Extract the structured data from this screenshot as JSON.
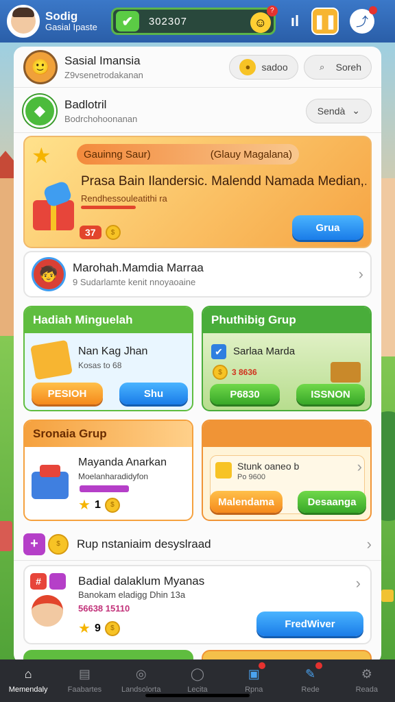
{
  "topbar": {
    "brand_title": "Sodig",
    "brand_subtitle": "Gasial Ipaste",
    "progress_value": "302307",
    "notif_count": "?",
    "signal_icon": "signal-bars-icon",
    "pause_icon": "pause-icon",
    "share_icon": "share-icon"
  },
  "profile": {
    "name": "Sasial Imansia",
    "subtitle": "Z9vsenetrodakanan",
    "pill_left": "sadoo",
    "pill_right": "Soreh"
  },
  "group_row": {
    "title": "Badlotril",
    "subtitle": "Bodrchohoonanan",
    "select_label": "Sendà"
  },
  "banner": {
    "tag_left": "Gauinng Saur)",
    "tag_right": "(Glauy Magalana)",
    "headline": "Prasa Bain Ilandersic. Malendd Namada Median,..",
    "subline": "Rendhessouleatithi ra",
    "count": "37",
    "button": "Grua",
    "colors": {
      "bg_start": "#ffe08a",
      "bg_end": "#f59d3c"
    }
  },
  "member_row": {
    "title": "Marohah.Mamdia Marraa",
    "subtitle": "9 Sudarlamte kenit nnoyaoaine"
  },
  "card_hadiah": {
    "header": "Hadiah Minguelah",
    "title": "Nan Kag Jhan",
    "subtitle": "Kosas to 68",
    "btn_left": "PESIOH",
    "btn_right": "Shu",
    "header_color": "#5fbd3f"
  },
  "card_phuthing": {
    "header": "Phuthibig Grup",
    "title": "Sarlaa Marda",
    "points": "3 8636",
    "btn_left": "P6830",
    "btn_right": "ISSNON",
    "header_color": "#49ad3a"
  },
  "card_sronaia": {
    "header": "Sronaia Grup",
    "title": "Mayanda Anarkan",
    "subtitle": "Moelanharadidyfon",
    "stars": "1",
    "header_color": "#f5a13e"
  },
  "card_stunk": {
    "title": "Stunk oaneo b",
    "subtitle": "Po 9600",
    "btn_left": "Malendama",
    "btn_right": "Desaanga",
    "header_color": "#f09436"
  },
  "row_rup": {
    "title": "Rup nstaniaim desyslraad"
  },
  "row_badial": {
    "title": "Badial dalaklum Myanas",
    "subtitle": "Banokam eladigg Dhin 13a",
    "points": "56638 15110",
    "stars": "9",
    "button": "FredWiver"
  },
  "bottomnav": {
    "items": [
      {
        "label": "Memendaly",
        "icon": "home-icon"
      },
      {
        "label": "Faabartes",
        "icon": "note-icon"
      },
      {
        "label": "Landsolorta",
        "icon": "globe-icon"
      },
      {
        "label": "Lecita",
        "icon": "chat-icon"
      },
      {
        "label": "Rpna",
        "icon": "tasks-icon"
      },
      {
        "label": "Rede",
        "icon": "edit-icon"
      },
      {
        "label": "Reada",
        "icon": "settings-icon"
      }
    ]
  }
}
